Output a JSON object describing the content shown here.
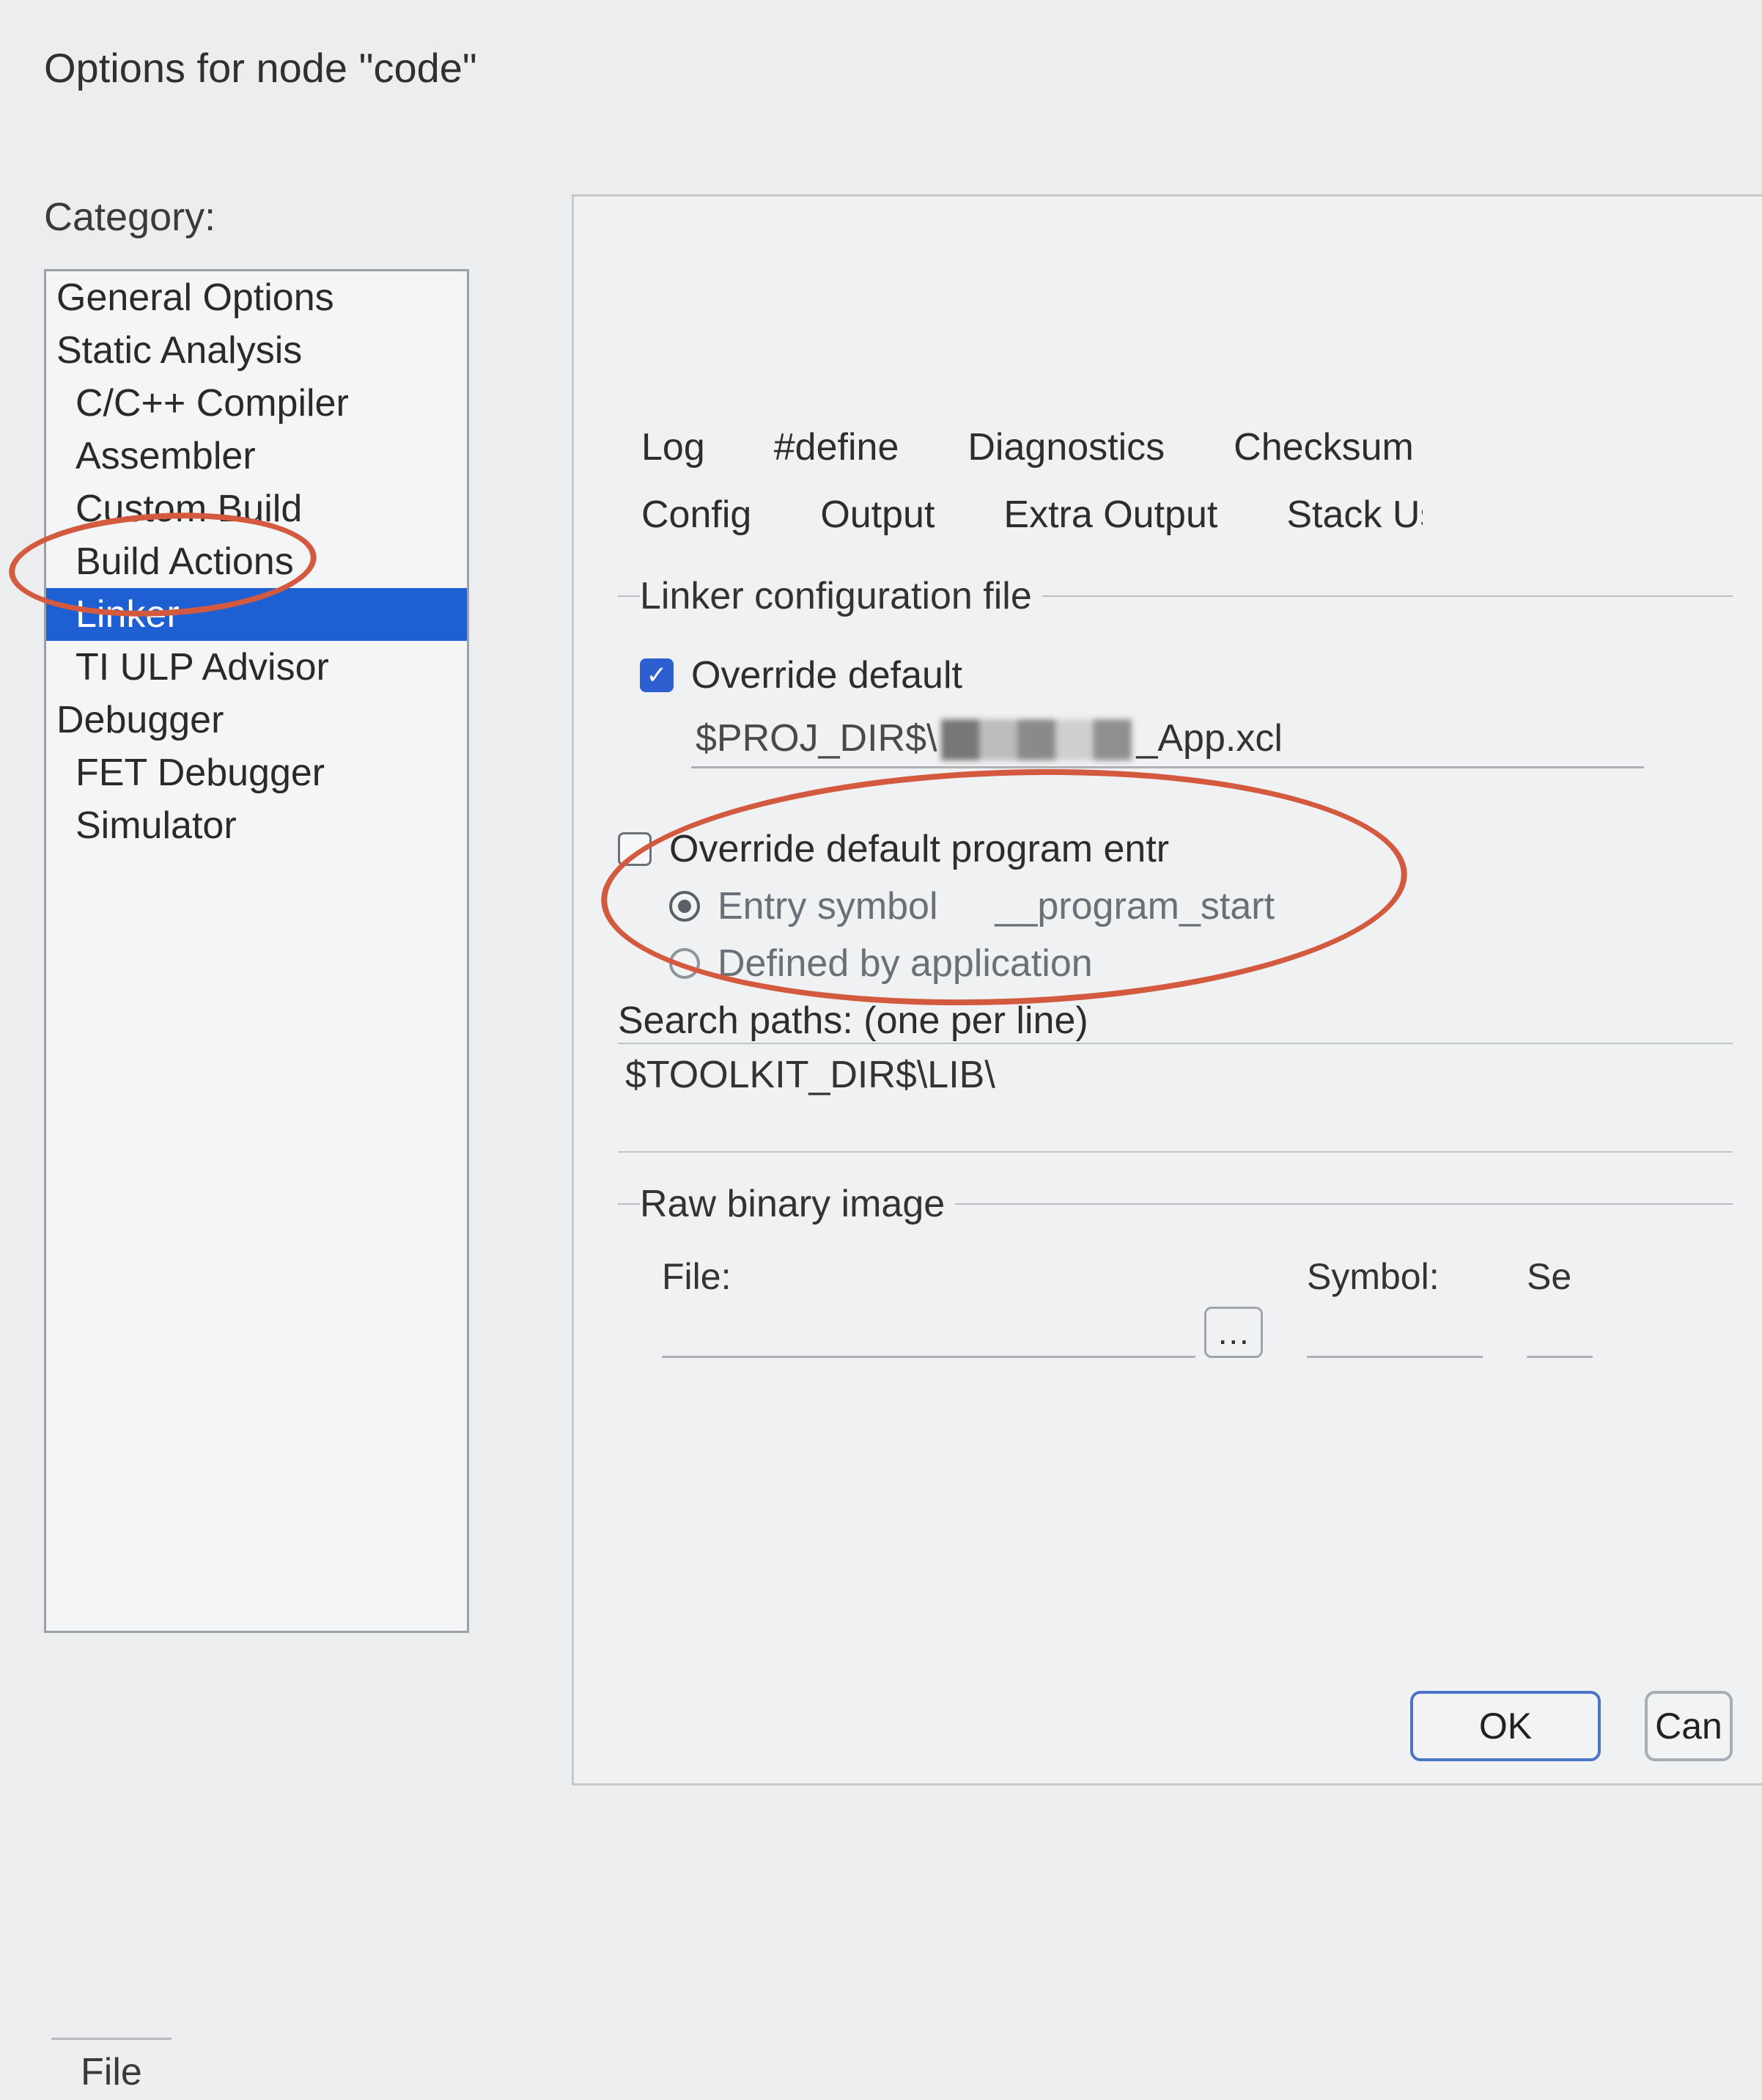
{
  "window": {
    "title": "Options for node \"code\""
  },
  "sidebar": {
    "label": "Category:",
    "items": [
      {
        "label": "General Options",
        "indent": false
      },
      {
        "label": "Static Analysis",
        "indent": false
      },
      {
        "label": "C/C++ Compiler",
        "indent": true
      },
      {
        "label": "Assembler",
        "indent": true
      },
      {
        "label": "Custom Build",
        "indent": true
      },
      {
        "label": "Build Actions",
        "indent": true
      },
      {
        "label": "Linker",
        "indent": true,
        "selected": true
      },
      {
        "label": "TI ULP Advisor",
        "indent": true
      },
      {
        "label": "Debugger",
        "indent": false
      },
      {
        "label": "FET Debugger",
        "indent": true
      },
      {
        "label": "Simulator",
        "indent": true
      }
    ]
  },
  "tabs": {
    "row1": [
      "Log",
      "#define",
      "Diagnostics",
      "Checksum"
    ],
    "row2": [
      "Config",
      "Output",
      "Extra Output",
      "Stack Us"
    ]
  },
  "config": {
    "group_label": "Linker configuration file",
    "override_label": "Override default",
    "override_checked": true,
    "path_prefix": "$PROJ_DIR$\\",
    "path_suffix": "_App.xcl"
  },
  "entry": {
    "override_label": "Override default program entr",
    "override_checked": false,
    "radio_entry_label": "Entry symbol",
    "entry_value": "__program_start",
    "radio_defined_label": "Defined by application"
  },
  "search": {
    "label": "Search paths:  (one per line)",
    "value": "$TOOLKIT_DIR$\\LIB\\"
  },
  "raw": {
    "group_label": "Raw binary image",
    "file_label": "File:",
    "symbol_label": "Symbol:",
    "seg_label": "Se"
  },
  "footer": {
    "ok": "OK",
    "cancel": "Can"
  },
  "bottom_tab": "File"
}
